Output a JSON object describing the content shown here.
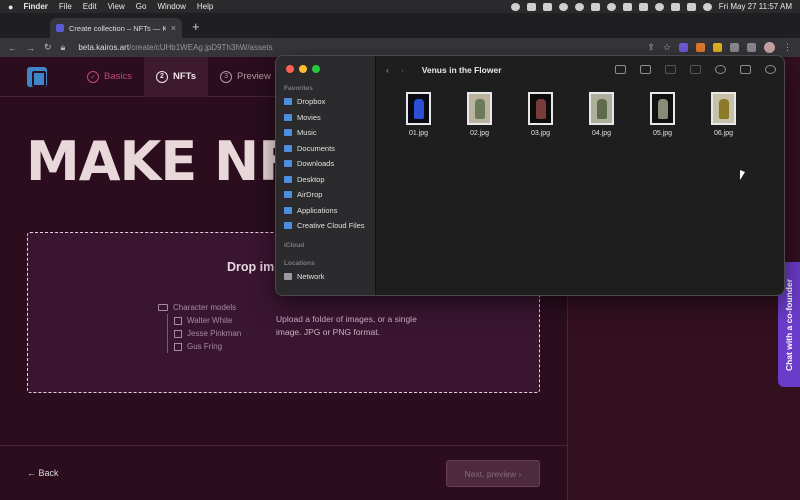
{
  "menubar": {
    "app": "Finder",
    "items": [
      "File",
      "Edit",
      "View",
      "Go",
      "Window",
      "Help"
    ],
    "clock": "Fri May 27  11:57 AM"
  },
  "browser": {
    "tab_title": "Create collection – NFTs — Ka",
    "url_host": "beta.kairos.art",
    "url_path": "/create/cUHb1WEAg.jpD9Th3hW/assets"
  },
  "site": {
    "steps": [
      {
        "label": "Basics",
        "num": "✓"
      },
      {
        "label": "NFTs",
        "num": "2"
      },
      {
        "label": "Preview",
        "num": "3"
      }
    ],
    "headline": "MAKE NFTS",
    "dropzone": {
      "title": "Drop im",
      "folder": "Character models",
      "files": [
        "Walter White",
        "Jesse Pinkman",
        "Gus Fring"
      ],
      "hint": "Upload a folder of images, or a single image. JPG or PNG format."
    },
    "back_label": "← Back",
    "next_label": "Next, preview  ›",
    "chat_label": "Chat with a co-founder"
  },
  "finder": {
    "title": "Venus in the Flower",
    "sections": {
      "favorites": "Favorites",
      "icloud": "iCloud",
      "locations": "Locations"
    },
    "favorites": [
      "Dropbox",
      "Movies",
      "Music",
      "Documents",
      "Downloads",
      "Desktop",
      "AirDrop",
      "Applications",
      "Creative Cloud Files"
    ],
    "locations": [
      "Network"
    ],
    "files": [
      "01.jpg",
      "02.jpg",
      "03.jpg",
      "04.jpg",
      "05.jpg",
      "06.jpg"
    ]
  },
  "colors": {
    "accent_pink": "#c2477a",
    "chat_purple": "#6b3cc9",
    "page_bg": "#2b0d1e",
    "logo_blue": "#3f86c9"
  }
}
